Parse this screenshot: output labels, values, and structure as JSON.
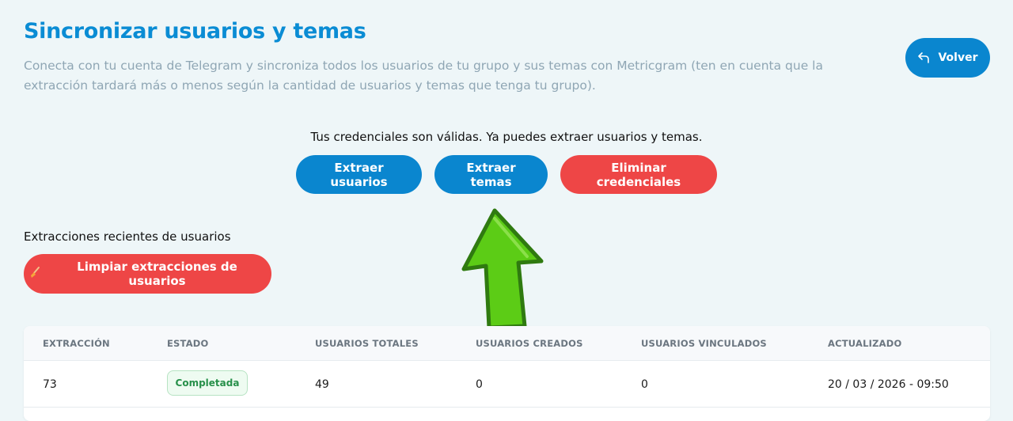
{
  "header": {
    "title": "Sincronizar usuarios y temas",
    "description": "Conecta con tu cuenta de Telegram y sincroniza todos los usuarios de tu grupo y sus temas con Metricgram (ten en cuenta que la extracción tardará más o menos según la cantidad de usuarios y temas que tenga tu grupo).",
    "back_label": "Volver"
  },
  "credentials": {
    "message": "Tus credenciales son válidas. Ya puedes extraer usuarios y temas.",
    "extract_users_label": "Extraer usuarios",
    "extract_topics_label": "Extraer temas",
    "delete_credentials_label": "Eliminar credenciales"
  },
  "recent": {
    "title": "Extracciones recientes de usuarios",
    "clean_label": "Limpiar extracciones de usuarios",
    "clean_icon": "broom-icon"
  },
  "table": {
    "columns": [
      "EXTRACCIÓN",
      "ESTADO",
      "USUARIOS TOTALES",
      "USUARIOS CREADOS",
      "USUARIOS VINCULADOS",
      "ACTUALIZADO"
    ],
    "rows": [
      {
        "extraction": "73",
        "status": "Completada",
        "total": "49",
        "created": "0",
        "linked": "0",
        "updated": "20 / 03 / 2026 - 09:50"
      }
    ]
  },
  "colors": {
    "primary": "#0a86cf",
    "danger": "#ee4646",
    "success": "#27904a",
    "arrow": "#5ccc16"
  }
}
